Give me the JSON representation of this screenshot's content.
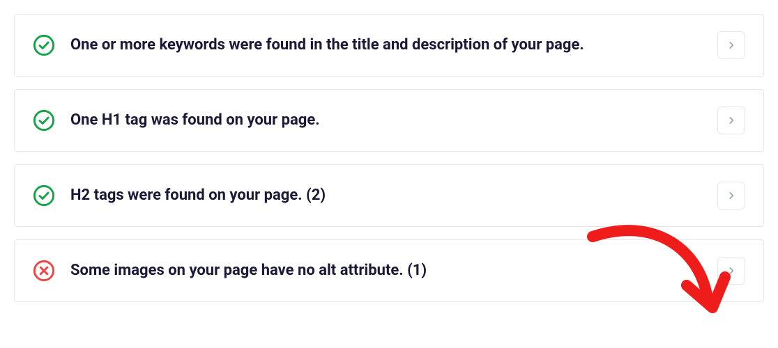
{
  "checks": [
    {
      "status": "pass",
      "message": "One or more keywords were found in the title and description of your page."
    },
    {
      "status": "pass",
      "message": "One H1 tag was found on your page."
    },
    {
      "status": "pass",
      "message": "H2 tags were found on your page. (2)"
    },
    {
      "status": "fail",
      "message": "Some images on your page have no alt attribute. (1)"
    }
  ],
  "colors": {
    "pass": "#16a34a",
    "fail": "#ef4444",
    "chevron": "#9ca3af",
    "annotation": "#ef1c1c"
  }
}
